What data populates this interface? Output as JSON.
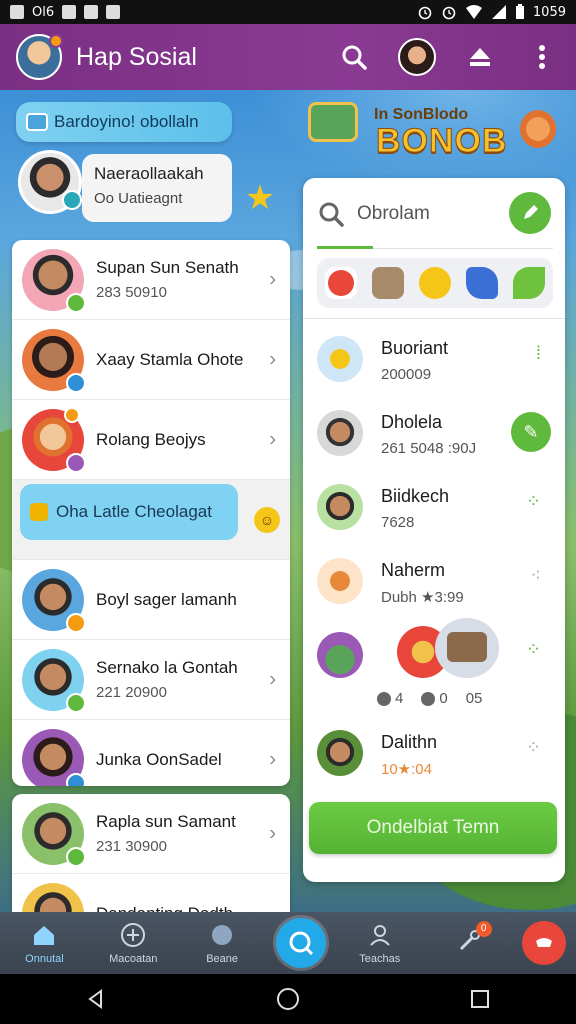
{
  "status_bar": {
    "left_text": "Ol6",
    "time": "1059"
  },
  "app_bar": {
    "title": "Hap Sosial"
  },
  "top_chip": {
    "label": "Bardoyino! obollaln"
  },
  "profile_card": {
    "name": "Naeraollaakah",
    "subtitle": "Oo Uatieagnt"
  },
  "contacts": [
    {
      "name": "Supan Sun Senath",
      "meta": "283 50910",
      "avatar_bg": "#f3a6b6",
      "badge": "#5fb93c"
    },
    {
      "name": "Xaay Stamla Ohote",
      "meta": "",
      "avatar_bg": "#e97a3f",
      "badge": "#2f8fd6"
    },
    {
      "name": "Rolang Beojys",
      "meta": "",
      "avatar_bg": "#e8463b",
      "badge": "#9b59b6"
    },
    {
      "name": "Boyl sager lamanh",
      "meta": "",
      "avatar_bg": "#5aa6de",
      "badge": "#f39c12"
    },
    {
      "name": "Sernako la Gontah",
      "meta": "221 20900",
      "avatar_bg": "#7fd1f0",
      "badge": "#5fb93c"
    },
    {
      "name": "Junka OonSadel",
      "meta": "",
      "avatar_bg": "#9b59b6",
      "badge": "#2f8fd6"
    }
  ],
  "selected_pill": {
    "label": "Oha Latle Cheolagat"
  },
  "contacts_more": [
    {
      "name": "Rapla sun Samant",
      "meta": "231 30900",
      "avatar_bg": "#8ac06a",
      "badge": "#5fb93c"
    },
    {
      "name": "Dandanting Dadth",
      "meta": "",
      "avatar_bg": "#f1c24a",
      "badge": "#f39c12"
    }
  ],
  "bonus": {
    "small": "In SonBlodo",
    "big": "BONOB"
  },
  "search": {
    "placeholder": "Obrolam"
  },
  "friends": [
    {
      "name": "Buoriant",
      "meta": "200009",
      "avatar_bg": "#cfe6f7"
    },
    {
      "name": "Dholela",
      "meta": "261 5048 :90J",
      "avatar_bg": "#d8d8d8"
    },
    {
      "name": "Biidkech",
      "meta": "7628",
      "avatar_bg": "#b8e0a0"
    },
    {
      "name": "Naherm",
      "meta": "Dubh ★3:99",
      "avatar_bg": "#fde3c8"
    },
    {
      "name": "Dalithn",
      "meta": "10★:04",
      "avatar_bg": "#5a8f3a"
    }
  ],
  "reactions": {
    "a": "4",
    "b": "0",
    "c": "05"
  },
  "cta": {
    "label": "Ondelbiat Temn"
  },
  "bottom_nav": [
    {
      "label": "Onnutal"
    },
    {
      "label": "Macoatan"
    },
    {
      "label": "Beane"
    },
    {
      "label": "Teachas"
    }
  ],
  "bottom_nav_badge": "0",
  "colors": {
    "app_bar": "#7a2f83",
    "accent_green": "#5fb93c",
    "accent_blue": "#22a9e8",
    "accent_red": "#e8463b"
  }
}
